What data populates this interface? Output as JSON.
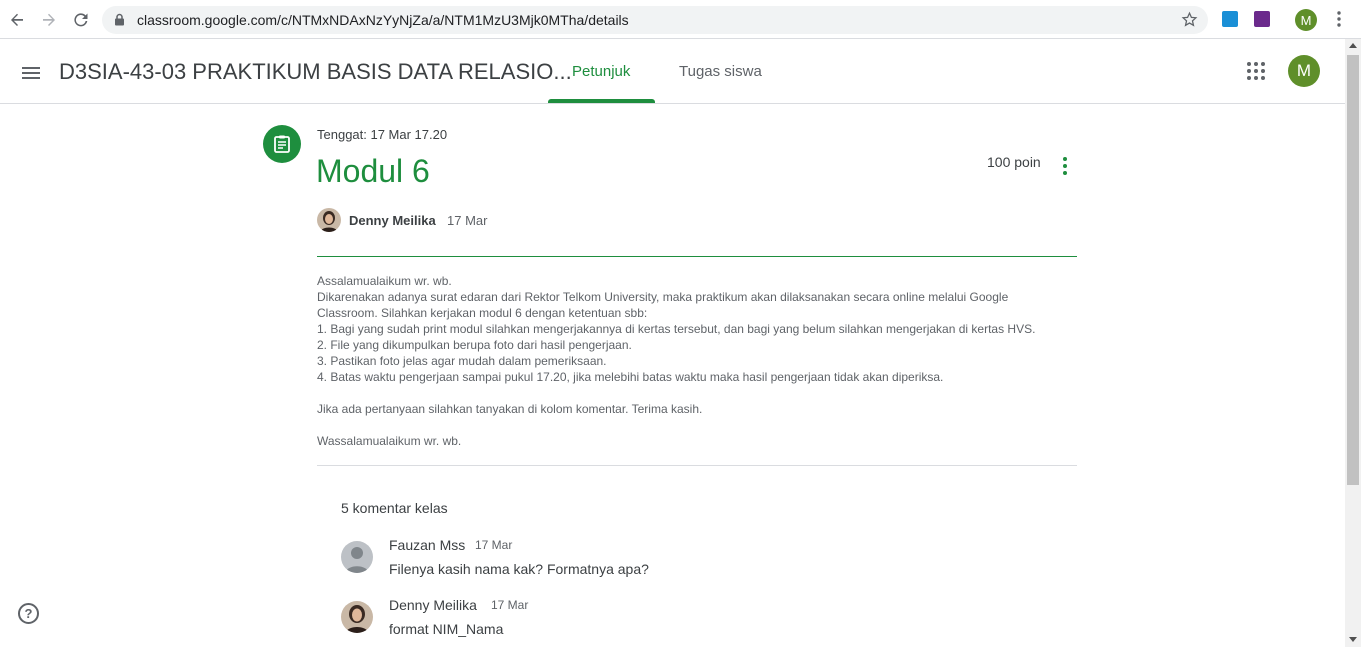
{
  "browser": {
    "url": "classroom.google.com/c/NTMxNDAxNzYyNjZa/a/NTM1MzU3Mjk0MTha/details",
    "profile_initial": "M"
  },
  "header": {
    "class_title": "D3SIA-43-03 PRAKTIKUM BASIS DATA RELASIO...",
    "tabs": [
      {
        "label": "Petunjuk",
        "active": true
      },
      {
        "label": "Tugas siswa",
        "active": false
      }
    ],
    "user_initial": "M",
    "accent_color": "#1e8e3e"
  },
  "assignment": {
    "due": "Tenggat: 17 Mar 17.20",
    "title": "Modul 6",
    "points": "100 poin",
    "author": "Denny Meilika",
    "date": "17 Mar",
    "body": [
      "Assalamualaikum wr. wb.",
      "Dikarenakan adanya surat edaran dari Rektor Telkom University, maka praktikum akan dilaksanakan secara online melalui Google",
      "Classroom. Silahkan kerjakan modul 6 dengan ketentuan sbb:",
      "1. Bagi yang sudah print modul silahkan mengerjakannya di kertas tersebut, dan bagi yang belum silahkan mengerjakan di kertas HVS.",
      "2. File yang dikumpulkan berupa foto dari hasil pengerjaan.",
      "3. Pastikan foto jelas agar mudah dalam pemeriksaan.",
      "4. Batas waktu pengerjaan sampai pukul 17.20, jika melebihi batas waktu maka hasil pengerjaan tidak akan diperiksa.",
      "",
      "Jika ada pertanyaan silahkan tanyakan di kolom komentar. Terima kasih.",
      "",
      "Wassalamualaikum wr. wb."
    ]
  },
  "comments": {
    "header": "5 komentar kelas",
    "items": [
      {
        "name": "Fauzan Mss",
        "date": "17 Mar",
        "text": "Filenya kasih nama kak? Formatnya apa?"
      },
      {
        "name": "Denny Meilika",
        "date": "17 Mar",
        "text": "format NIM_Nama"
      }
    ]
  },
  "help_label": "?"
}
